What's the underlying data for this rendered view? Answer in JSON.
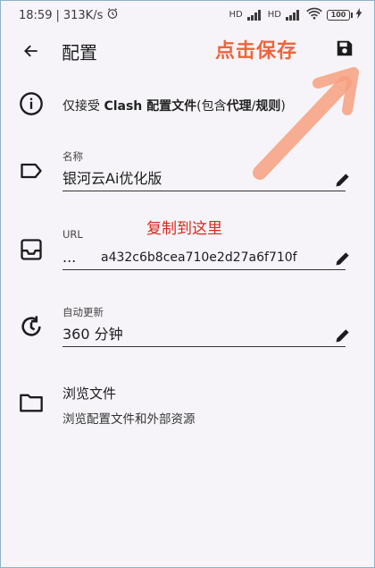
{
  "status_bar": {
    "time": "18:59",
    "speed": "313K/s",
    "signal_labels": [
      "HD",
      "HD"
    ],
    "battery": "100"
  },
  "app_bar": {
    "title": "配置",
    "back_icon": "arrow-left-icon",
    "save_icon": "save-icon"
  },
  "annotations": {
    "save_hint": "点击保存",
    "copy_hint": "复制到这里",
    "accent_color": "#f0643a"
  },
  "info": {
    "prefix": "仅接受 ",
    "bold_part": "Clash 配置文件",
    "middle": "(包含",
    "bold_part2": "代理",
    "slash": "/",
    "bold_part3": "规则",
    "suffix": ")"
  },
  "fields": {
    "name": {
      "label": "名称",
      "value": "银河云Ai优化版"
    },
    "url": {
      "label": "URL",
      "ellipsis": "...",
      "value": "a432c6b8cea710e2d27a6f710f"
    },
    "auto_update": {
      "label": "自动更新",
      "value": "360 分钟"
    }
  },
  "browse": {
    "title": "浏览文件",
    "description": "浏览配置文件和外部资源"
  }
}
